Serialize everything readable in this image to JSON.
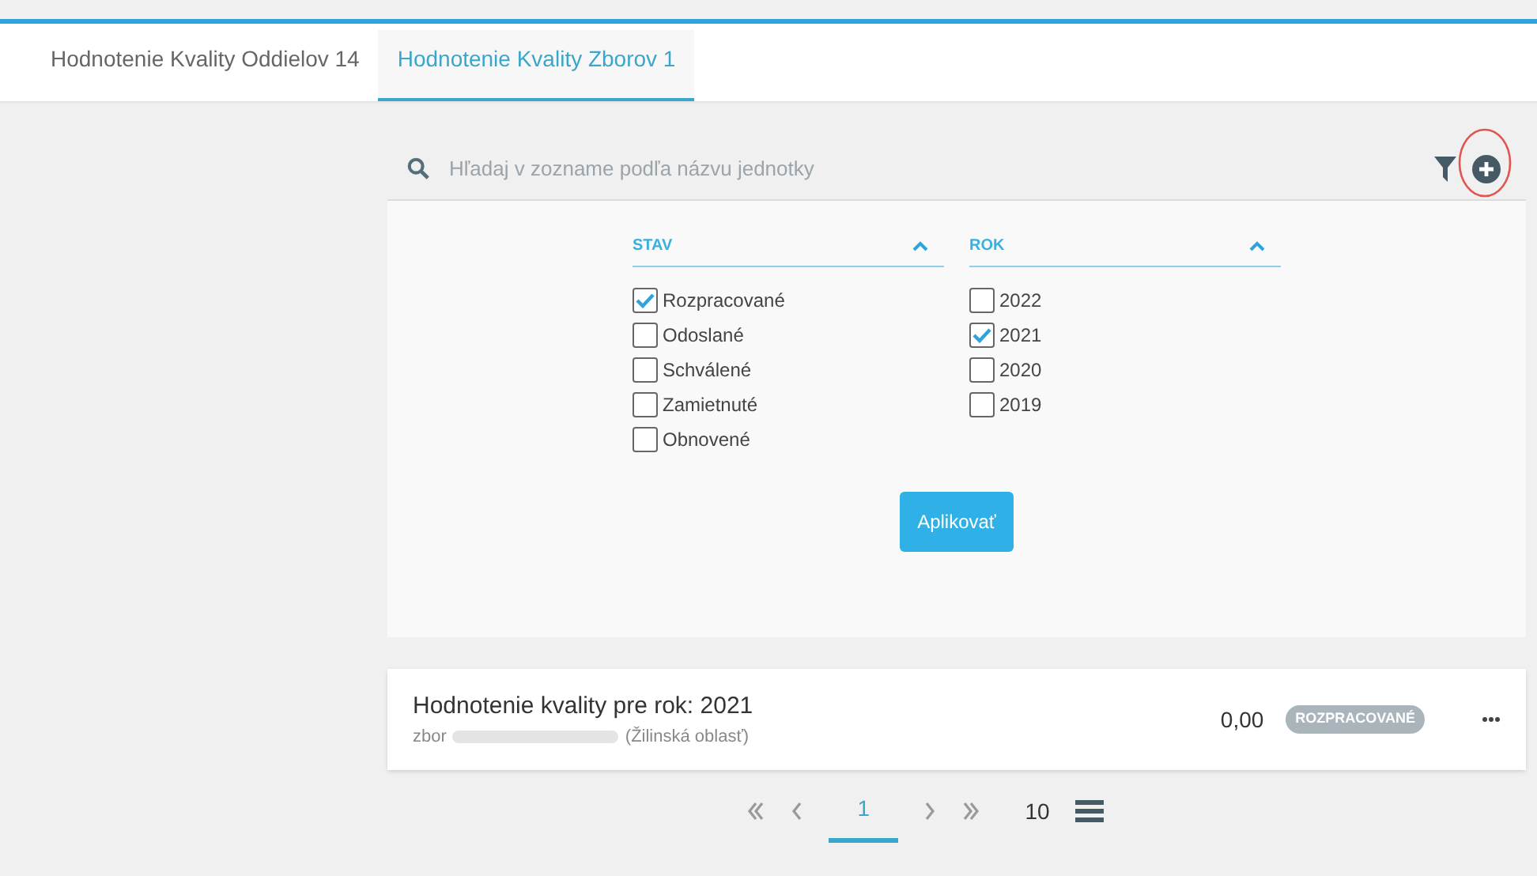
{
  "tabs": [
    {
      "label": "Hodnotenie Kvality Oddielov 14",
      "selected": false
    },
    {
      "label": "Hodnotenie Kvality Zborov 1",
      "selected": true
    }
  ],
  "search": {
    "placeholder": "Hľadaj v zozname podľa názvu jednotky"
  },
  "filters": [
    {
      "title": "STAV",
      "expanded": true,
      "options": [
        {
          "label": "Rozpracované",
          "checked": true
        },
        {
          "label": "Odoslané",
          "checked": false
        },
        {
          "label": "Schválené",
          "checked": false
        },
        {
          "label": "Zamietnuté",
          "checked": false
        },
        {
          "label": "Obnovené",
          "checked": false
        }
      ]
    },
    {
      "title": "ROK",
      "expanded": true,
      "options": [
        {
          "label": "2022",
          "checked": false
        },
        {
          "label": "2021",
          "checked": true
        },
        {
          "label": "2020",
          "checked": false
        },
        {
          "label": "2019",
          "checked": false
        }
      ]
    }
  ],
  "apply_button": "Aplikovať",
  "items": [
    {
      "title": "Hodnotenie kvality pre rok: 2021",
      "unit": "zbor",
      "region": "(Žilinská oblasť)",
      "score": "0,00",
      "status": "ROZPRACOVANÉ"
    }
  ],
  "pagination": {
    "pages": [
      {
        "label": "1",
        "selected": true
      }
    ],
    "page_size": "10"
  }
}
